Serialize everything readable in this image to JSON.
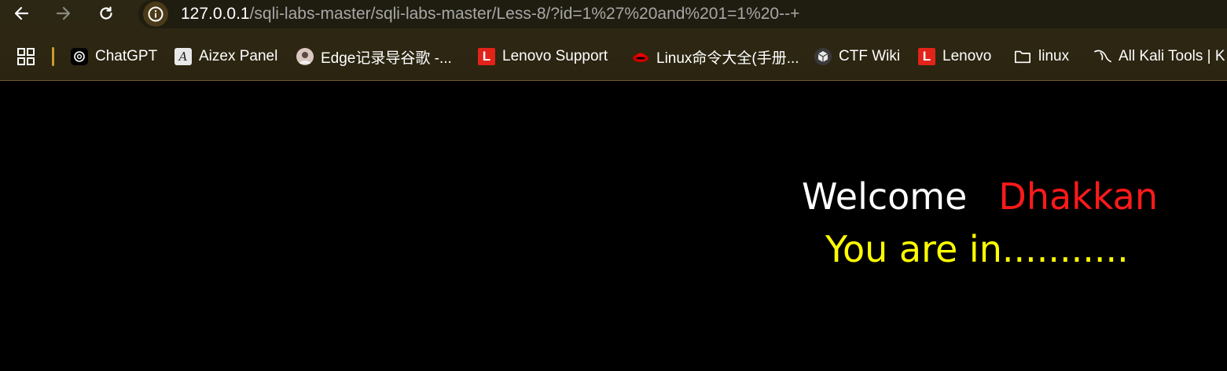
{
  "browser": {
    "url_host": "127.0.0.1",
    "url_path": "/sqli-labs-master/sqli-labs-master/Less-8/?id=1%27%20and%201=1%20--+",
    "nav": {
      "back_icon": "arrow-left",
      "forward_icon": "arrow-right",
      "reload_icon": "reload"
    },
    "site_info_icon": "info-circle"
  },
  "bookmarks": [
    {
      "label": "ChatGPT",
      "icon": "chatgpt-logo"
    },
    {
      "label": "Aizex Panel",
      "icon": "aizex-logo"
    },
    {
      "label": "Edge记录导谷歌 -...",
      "icon": "avatar"
    },
    {
      "label": "Lenovo Support",
      "icon": "lenovo-logo",
      "glyph": "L"
    },
    {
      "label": "Linux命令大全(手册...",
      "icon": "redhat-logo"
    },
    {
      "label": "CTF Wiki",
      "icon": "ctf-wiki-logo"
    },
    {
      "label": "Lenovo",
      "icon": "lenovo-logo",
      "glyph": "L"
    },
    {
      "label": "linux",
      "icon": "folder"
    },
    {
      "label": "All Kali Tools | K",
      "icon": "kali-logo"
    }
  ],
  "page": {
    "welcome": "Welcome",
    "name": "Dhakkan",
    "message": "You are in..........."
  },
  "colors": {
    "background": "#000000",
    "welcome": "#ffffff",
    "name": "#ff1a1a",
    "message": "#ffff00"
  }
}
